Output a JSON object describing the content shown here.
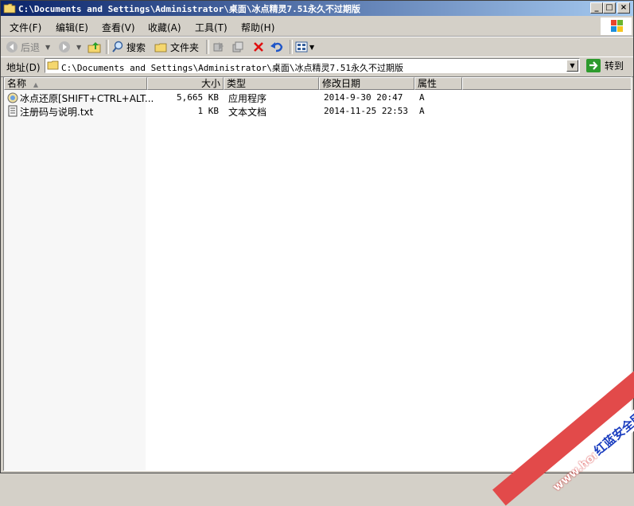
{
  "window": {
    "title": "C:\\Documents and Settings\\Administrator\\桌面\\冰点精灵7.51永久不过期版",
    "controls": {
      "minimize": "_",
      "maximize": "□",
      "close": "×"
    }
  },
  "menu": [
    "文件(F)",
    "编辑(E)",
    "查看(V)",
    "收藏(A)",
    "工具(T)",
    "帮助(H)"
  ],
  "toolbar": {
    "back": "后退",
    "search": "搜索",
    "folders": "文件夹"
  },
  "address": {
    "label": "地址(D)",
    "value": "C:\\Documents and Settings\\Administrator\\桌面\\冰点精灵7.51永久不过期版",
    "go": "转到"
  },
  "columns": [
    "名称",
    "大小",
    "类型",
    "修改日期",
    "属性"
  ],
  "files": [
    {
      "name": "冰点还原[SHIFT+CTRL+ALT...",
      "size": "5,665 KB",
      "type": "应用程序",
      "modified": "2014-9-30 20:47",
      "attr": "A",
      "icon": "exe-icon"
    },
    {
      "name": "注册码与说明.txt",
      "size": "1 KB",
      "type": "文本文档",
      "modified": "2014-11-25 22:53",
      "attr": "A",
      "icon": "text-file-icon"
    }
  ],
  "watermark": {
    "line1": "www.hongcha.com",
    "line2": "红蓝安全网"
  }
}
